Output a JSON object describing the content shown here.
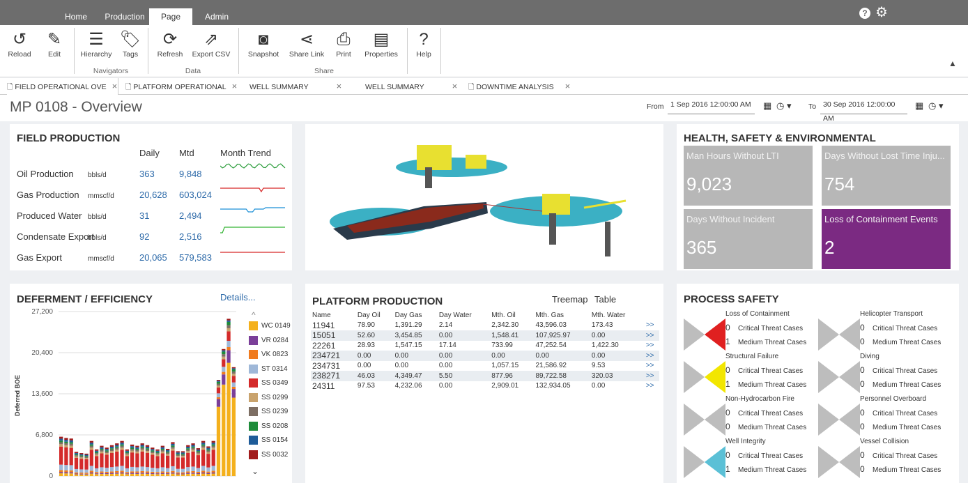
{
  "menu": {
    "tabs": [
      "Home",
      "Production",
      "Page",
      "Admin"
    ],
    "active": "Page"
  },
  "ribbon": {
    "buttons": [
      {
        "label": "Reload",
        "icon": "reload-icon"
      },
      {
        "label": "Edit",
        "icon": "edit-icon"
      },
      {
        "label": "Hierarchy",
        "icon": "hierarchy-icon"
      },
      {
        "label": "Tags",
        "icon": "tag-icon"
      },
      {
        "label": "Refresh",
        "icon": "refresh-icon"
      },
      {
        "label": "Export CSV",
        "icon": "export-icon"
      },
      {
        "label": "Snapshot",
        "icon": "camera-icon"
      },
      {
        "label": "Share Link",
        "icon": "share-icon"
      },
      {
        "label": "Print",
        "icon": "print-icon"
      },
      {
        "label": "Properties",
        "icon": "properties-icon"
      },
      {
        "label": "Help",
        "icon": "help-icon"
      }
    ],
    "groups": [
      "Navigators",
      "Data",
      "Share"
    ]
  },
  "doc_tabs": [
    "FIELD OPERATIONAL OVE",
    "PLATFORM OPERATIONAL",
    "WELL SUMMARY",
    "WELL SUMMARY",
    "DOWNTIME ANALYSIS"
  ],
  "page": {
    "title": "MP 0108 - Overview",
    "from_label": "From",
    "from_value": "1 Sep 2016 12:00:00 AM",
    "to_label": "To",
    "to_value": "30 Sep 2016 12:00:00 AM"
  },
  "field_production": {
    "title": "FIELD PRODUCTION",
    "headers": [
      "Daily",
      "Mtd",
      "Month Trend"
    ],
    "rows": [
      {
        "name": "Oil Production",
        "unit": "bbls/d",
        "daily": "363",
        "mtd": "9,848",
        "color": "#2a9d3a"
      },
      {
        "name": "Gas Production",
        "unit": "mmscf/d",
        "daily": "20,628",
        "mtd": "603,024",
        "color": "#d62828"
      },
      {
        "name": "Produced Water",
        "unit": "bbls/d",
        "daily": "31",
        "mtd": "2,494",
        "color": "#1a8fd6"
      },
      {
        "name": "Condensate Export",
        "unit": "bbls/d",
        "daily": "92",
        "mtd": "2,516",
        "color": "#35b535"
      },
      {
        "name": "Gas Export",
        "unit": "mmscf/d",
        "daily": "20,065",
        "mtd": "579,583",
        "color": "#d62828"
      }
    ]
  },
  "hse": {
    "title": "HEALTH, SAFETY & ENVIRONMENTAL",
    "tiles": [
      {
        "label": "Man Hours Without LTI",
        "value": "9,023",
        "color": "#b7b7b7"
      },
      {
        "label": "Days Without Lost Time Inju...",
        "value": "754",
        "color": "#b7b7b7"
      },
      {
        "label": "Days Without Incident",
        "value": "365",
        "color": "#b7b7b7"
      },
      {
        "label": "Loss of Containment Events",
        "value": "2",
        "color": "#7b2a82"
      }
    ]
  },
  "deferment": {
    "title": "DEFERMENT / EFFICIENCY",
    "details": "Details...",
    "ylabel": "Deferred BOE",
    "legend": [
      {
        "name": "WC 0149",
        "color": "#f4b01c"
      },
      {
        "name": "VR 0284",
        "color": "#7b3f99"
      },
      {
        "name": "VK 0823",
        "color": "#f07b1f"
      },
      {
        "name": "ST 0314",
        "color": "#9fb8d8"
      },
      {
        "name": "SS 0349",
        "color": "#d42a2a"
      },
      {
        "name": "SS 0299",
        "color": "#c9a36d"
      },
      {
        "name": "SS 0239",
        "color": "#7d6e63"
      },
      {
        "name": "SS 0208",
        "color": "#1e8c3a"
      },
      {
        "name": "SS 0154",
        "color": "#1f5c99"
      },
      {
        "name": "SS 0032",
        "color": "#a11b1b"
      }
    ]
  },
  "chart_data": {
    "type": "bar",
    "stacked": true,
    "ylabel": "Deferred BOE",
    "yticks": [
      "27,200",
      "20,400",
      "13,600",
      "6,800",
      "0"
    ],
    "ylim": [
      0,
      27200
    ],
    "values": [
      6500,
      6300,
      6200,
      4000,
      3800,
      3700,
      5800,
      4400,
      5000,
      4700,
      5100,
      5400,
      5800,
      4400,
      5200,
      5000,
      5400,
      5100,
      4700,
      4400,
      5000,
      4500,
      5600,
      4100,
      4100,
      5100,
      5400,
      4600,
      5800,
      4900,
      5800,
      15900,
      21000,
      26000,
      18000
    ]
  },
  "platform": {
    "title": "PLATFORM PRODUCTION",
    "views": [
      "Treemap",
      "Table"
    ],
    "columns": [
      "Name",
      "Day Oil",
      "Day Gas",
      "Day Water",
      "Mth. Oil",
      "Mth. Gas",
      "Mth. Water"
    ],
    "rows": [
      [
        "11941",
        "78.90",
        "1,391.29",
        "2.14",
        "2,342.30",
        "43,596.03",
        "173.43"
      ],
      [
        "15051",
        "52.60",
        "3,454.85",
        "0.00",
        "1,548.41",
        "107,925.97",
        "0.00"
      ],
      [
        "22261",
        "28.93",
        "1,547.15",
        "17.14",
        "733.99",
        "47,252.54",
        "1,422.30"
      ],
      [
        "234721",
        "0.00",
        "0.00",
        "0.00",
        "0.00",
        "0.00",
        "0.00"
      ],
      [
        "234731",
        "0.00",
        "0.00",
        "0.00",
        "1,057.15",
        "21,586.92",
        "9.53"
      ],
      [
        "238271",
        "46.03",
        "4,349.47",
        "5.50",
        "877.96",
        "89,722.58",
        "320.03"
      ],
      [
        "24311",
        "97.53",
        "4,232.06",
        "0.00",
        "2,909.01",
        "132,934.05",
        "0.00"
      ]
    ],
    "link": ">>"
  },
  "process_safety": {
    "title": "PROCESS SAFETY",
    "critical": "Critical Threat Cases",
    "medium": "Medium Threat Cases",
    "items": [
      {
        "name": "Loss of Containment",
        "critical": "0",
        "medium": "1",
        "color": "#e02020",
        "link": false
      },
      {
        "name": "Helicopter Transport",
        "critical": "0",
        "medium": "0",
        "color": "#bdbdbd",
        "link": false
      },
      {
        "name": "Structural Failure",
        "critical": "0",
        "medium": "1",
        "color": "#f2e600",
        "link": true
      },
      {
        "name": "Diving",
        "critical": "0",
        "medium": "0",
        "color": "#bdbdbd",
        "link": false
      },
      {
        "name": "Non-Hydrocarbon Fire",
        "critical": "0",
        "medium": "0",
        "color": "#bdbdbd",
        "link": false
      },
      {
        "name": "Personnel Overboard",
        "critical": "0",
        "medium": "0",
        "color": "#bdbdbd",
        "link": false
      },
      {
        "name": "Well Integrity",
        "critical": "0",
        "medium": "1",
        "color": "#5bc0d6",
        "link": true
      },
      {
        "name": "Vessel Collision",
        "critical": "0",
        "medium": "0",
        "color": "#bdbdbd",
        "link": false
      }
    ]
  }
}
